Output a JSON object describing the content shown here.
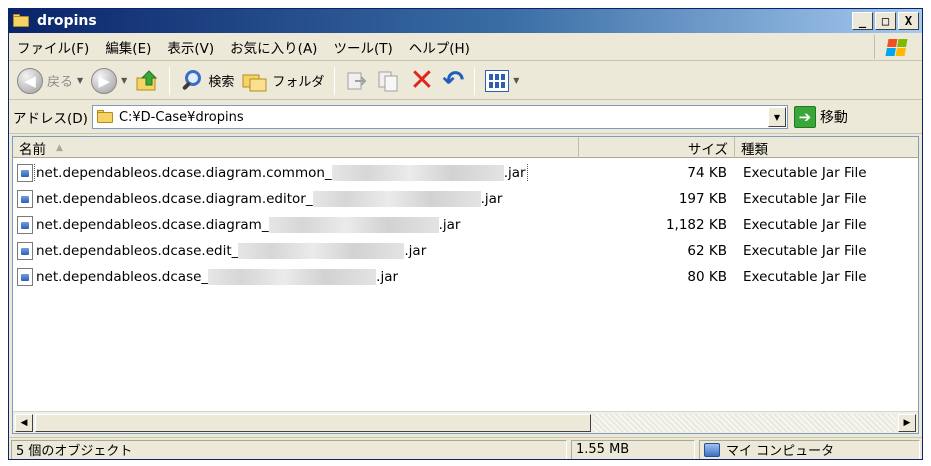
{
  "window": {
    "title": "dropins",
    "minimize": "_",
    "maximize": "□",
    "close": "X"
  },
  "menu": [
    {
      "label": "ファイル(F)"
    },
    {
      "label": "編集(E)"
    },
    {
      "label": "表示(V)"
    },
    {
      "label": "お気に入り(A)"
    },
    {
      "label": "ツール(T)"
    },
    {
      "label": "ヘルプ(H)"
    }
  ],
  "toolbar": {
    "back_label": "戻る",
    "search_label": "検索",
    "folders_label": "フォルダ"
  },
  "address": {
    "label": "アドレス(D)",
    "value": "C:¥D-Case¥dropins",
    "go_label": "移動"
  },
  "columns": {
    "name": "名前",
    "size": "サイズ",
    "type": "種類"
  },
  "files": [
    {
      "prefix": "net.dependableos.dcase.diagram.common_",
      "suffix": ".jar",
      "size": "74 KB",
      "type": "Executable Jar File"
    },
    {
      "prefix": "net.dependableos.dcase.diagram.editor_",
      "suffix": ".jar",
      "size": "197 KB",
      "type": "Executable Jar File"
    },
    {
      "prefix": "net.dependableos.dcase.diagram_",
      "suffix": ".jar",
      "size": "1,182 KB",
      "type": "Executable Jar File"
    },
    {
      "prefix": "net.dependableos.dcase.edit_",
      "suffix": ".jar",
      "size": "62 KB",
      "type": "Executable Jar File"
    },
    {
      "prefix": "net.dependableos.dcase_",
      "suffix": ".jar",
      "size": "80 KB",
      "type": "Executable Jar File"
    }
  ],
  "status": {
    "count": "5 個のオブジェクト",
    "total_size": "1.55 MB",
    "zone": "マイ コンピュータ"
  },
  "colors": {
    "titlebar_start": "#0a246a",
    "titlebar_end": "#a6caf0",
    "window_bg": "#ece9d8",
    "delete_red": "#e0251b",
    "go_green": "#3aa63a"
  }
}
